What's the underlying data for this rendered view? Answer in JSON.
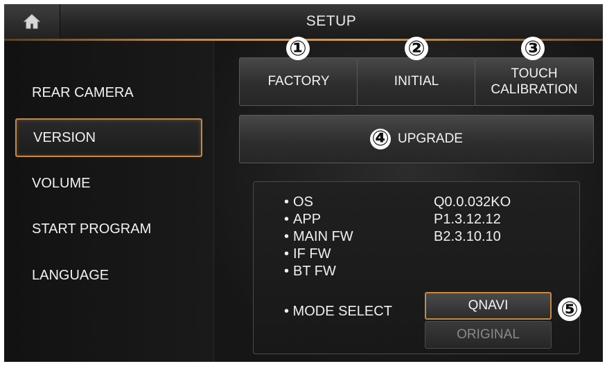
{
  "header": {
    "title": "SETUP",
    "home_icon": "home-icon"
  },
  "sidebar": {
    "items": [
      {
        "label": "REAR CAMERA",
        "active": false
      },
      {
        "label": "VERSION",
        "active": true
      },
      {
        "label": "VOLUME",
        "active": false
      },
      {
        "label": "START PROGRAM",
        "active": false
      },
      {
        "label": "LANGUAGE",
        "active": false
      }
    ]
  },
  "actions": {
    "factory_label": "FACTORY",
    "initial_label": "INITIAL",
    "touch_label_line1": "TOUCH",
    "touch_label_line2": "CALIBRATION",
    "upgrade_label": "UPGRADE"
  },
  "markers": {
    "m1": "①",
    "m2": "②",
    "m3": "③",
    "m4": "④",
    "m5": "⑤"
  },
  "version_info": {
    "rows": [
      {
        "bullet": "•",
        "label": "OS",
        "value": "Q0.0.032KO"
      },
      {
        "bullet": "•",
        "label": "APP",
        "value": "P1.3.12.12"
      },
      {
        "bullet": "•",
        "label": "MAIN FW",
        "value": "B2.3.10.10"
      },
      {
        "bullet": "•",
        "label": "IF FW",
        "value": ""
      },
      {
        "bullet": "•",
        "label": "BT FW",
        "value": ""
      }
    ],
    "mode_select_label": "• MODE SELECT",
    "mode_options": [
      "QNAVI",
      "ORIGINAL"
    ],
    "mode_selected": "QNAVI"
  },
  "colors": {
    "accent": "#c58a45",
    "background": "#151515",
    "text": "#f0f0f0",
    "disabled_text": "#8a8a8a"
  }
}
